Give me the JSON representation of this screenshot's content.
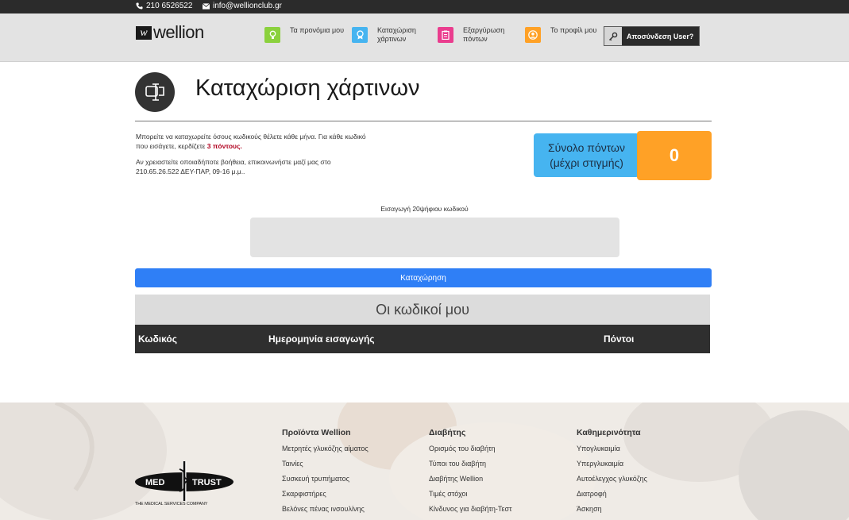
{
  "topbar": {
    "phone": "210 6526522",
    "email": "info@wellionclub.gr"
  },
  "logo": {
    "mark": "w",
    "word": "wellion"
  },
  "nav": [
    {
      "label": "Τα προνόμια μου",
      "icon": "lightbulb-icon",
      "color": "#8bd13d"
    },
    {
      "label": "Καταχώριση χάρτινων",
      "icon": "badge-icon",
      "color": "#46b4f0"
    },
    {
      "label": "Εξαργύρωση πόντων",
      "icon": "clipboard-icon",
      "color": "#ea3d8e"
    },
    {
      "label": "Το προφίλ μου",
      "icon": "user-icon",
      "color": "#ffa126"
    }
  ],
  "logout": {
    "label": "Αποσύνδεση User?",
    "icon": "key-icon"
  },
  "page": {
    "title": "Καταχώριση χάρτινων",
    "desc_part1": "Μπορείτε να καταχωρείτε όσους κωδικούς θέλετε κάθε μήνα. Για κάθε κωδικό που εισάγετε, κερδίζετε ",
    "desc_highlight": "3 πόντους.",
    "help": "Αν χρειαστείτε οποιαδήποτε βοήθεια, επικοινωνήστε μαζί μας στο 210.65.26.522 ΔΕΥ-ΠΑΡ, 09-16 μ.μ..",
    "points_label": "Σύνολο πόντων (μέχρι στιγμής)",
    "points_value": "0"
  },
  "form": {
    "code_label": "Εισαγωγή 20ψήφιου κωδικού",
    "code_value": "",
    "submit_label": "Καταχώρηση"
  },
  "codes": {
    "title": "Οι κωδικοί μου",
    "columns": [
      "Κωδικός",
      "Ημερομηνία εισαγωγής",
      "Πόντοι"
    ]
  },
  "footer": {
    "brand": {
      "name_left": "MED",
      "name_right": "TRUST",
      "tagline": "THE MEDICAL SERVICES COMPANY"
    },
    "columns": [
      {
        "heading": "Προϊόντα Wellion",
        "links": [
          "Μετρητές γλυκόζης αίματος",
          "Ταινίες",
          "Συσκευή τρυπήματος",
          "Σκαρφιστήρες",
          "Βελόνες πένας ινσουλίνης"
        ]
      },
      {
        "heading": "Διαβήτης",
        "links": [
          "Ορισμός του διαβήτη",
          "Τύποι του διαβήτη",
          "Διαβήτης Wellion",
          "Τιμές στόχοι",
          "Κίνδυνος για διαβήτη-Τεστ"
        ]
      },
      {
        "heading": "Καθημερινότητα",
        "links": [
          "Υπογλυκαιμία",
          "Υπεργλυκαιμία",
          "Αυτοέλεγχος γλυκόζης",
          "Διατροφή",
          "Άσκηση"
        ]
      }
    ]
  }
}
